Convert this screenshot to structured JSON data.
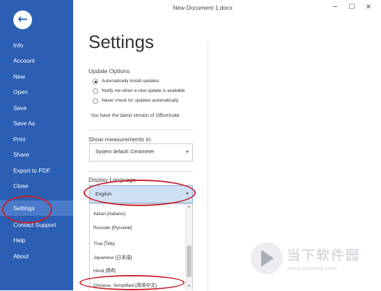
{
  "window": {
    "title": "New Document 1.docx"
  },
  "window_controls": {
    "minimize": "─",
    "maximize": "☐",
    "close": "✕"
  },
  "sidebar": {
    "back_icon": "←",
    "items": [
      {
        "label": "Info"
      },
      {
        "label": "Account"
      },
      {
        "label": "New"
      },
      {
        "label": "Open"
      },
      {
        "label": "Save"
      },
      {
        "label": "Save As"
      },
      {
        "label": "Print"
      },
      {
        "label": "Share"
      },
      {
        "label": "Export to PDF"
      },
      {
        "label": "Close"
      },
      {
        "label": "Settings",
        "active": true
      },
      {
        "label": "Contact Support"
      },
      {
        "label": "Help"
      },
      {
        "label": "About"
      }
    ]
  },
  "main": {
    "heading": "Settings",
    "update": {
      "label": "Update Options",
      "options": [
        {
          "label": "Automatically install updates",
          "checked": true
        },
        {
          "label": "Notify me when a new update is available",
          "checked": false
        },
        {
          "label": "Never check for updates automatically",
          "checked": false
        }
      ],
      "status": "You have the latest version of OfficeSuite."
    },
    "measurements": {
      "label": "Show measurements in:",
      "value": "System default: Centimeter",
      "caret": "▼"
    },
    "language": {
      "label": "Display Language",
      "value": "English",
      "caret": "▼",
      "options": [
        "Italian [Italiano]",
        "Russian [Русский]",
        "Thai [ไทย]",
        "Japanese [日本語]",
        "Hindi [हिंदी]",
        "Chinese, Simplified [简体中文]"
      ],
      "scroll_up": "▲",
      "scroll_down": "▼"
    }
  },
  "annotation_color": "#c8202a",
  "watermark": {
    "main": "当下软件园",
    "sub": "www.downxia.com"
  }
}
